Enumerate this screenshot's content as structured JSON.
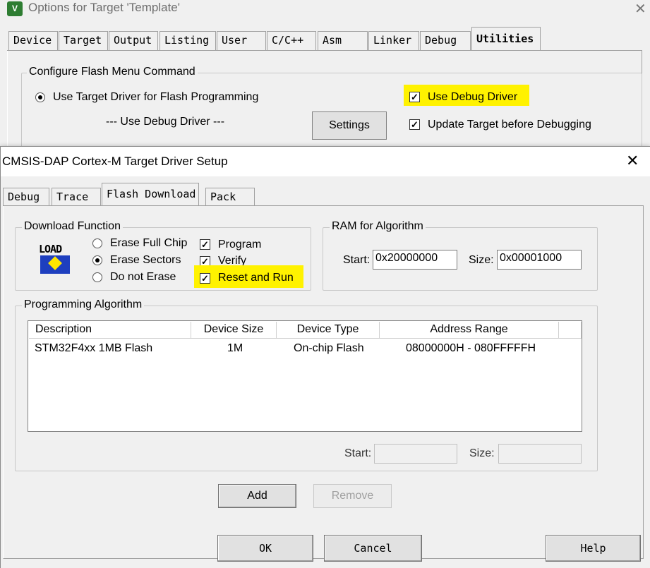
{
  "parent": {
    "title": "Options for Target 'Template'",
    "logo": "V",
    "tabs": [
      "Device",
      "Target",
      "Output",
      "Listing",
      "User",
      "C/C++",
      "Asm",
      "Linker",
      "Debug",
      "Utilities"
    ],
    "group_title": "Configure Flash Menu Command",
    "radio_target_driver": "Use Target Driver for Flash Programming",
    "use_debug_driver_label": "--- Use Debug Driver ---",
    "settings_button": "Settings",
    "chk_use_debug_driver": "Use Debug Driver",
    "chk_update_target": "Update Target before Debugging",
    "buttons": {
      "ok": "OK",
      "cancel": "Cancel",
      "help": "Help"
    }
  },
  "child": {
    "title": "CMSIS-DAP Cortex-M Target Driver Setup",
    "tabs": [
      "Debug",
      "Trace",
      "Flash Download",
      "Pack"
    ],
    "download_function": {
      "title": "Download Function",
      "load_icon_text": "LOAD",
      "radios": [
        "Erase Full Chip",
        "Erase Sectors",
        "Do not Erase"
      ],
      "selected": "Erase Sectors",
      "checks": [
        "Program",
        "Verify",
        "Reset and Run"
      ]
    },
    "ram": {
      "title": "RAM for Algorithm",
      "start_label": "Start:",
      "start_value": "0x20000000",
      "size_label": "Size:",
      "size_value": "0x00001000"
    },
    "algorithm": {
      "title": "Programming Algorithm",
      "columns": [
        "Description",
        "Device Size",
        "Device Type",
        "Address Range"
      ],
      "rows": [
        {
          "description": "STM32F4xx 1MB Flash",
          "size": "1M",
          "type": "On-chip Flash",
          "range": "08000000H - 080FFFFFH"
        }
      ],
      "start_label": "Start:",
      "size_label": "Size:"
    },
    "add_button": "Add",
    "remove_button": "Remove",
    "close_glyph": "✕"
  },
  "colors": {
    "highlight": "#fff200"
  }
}
